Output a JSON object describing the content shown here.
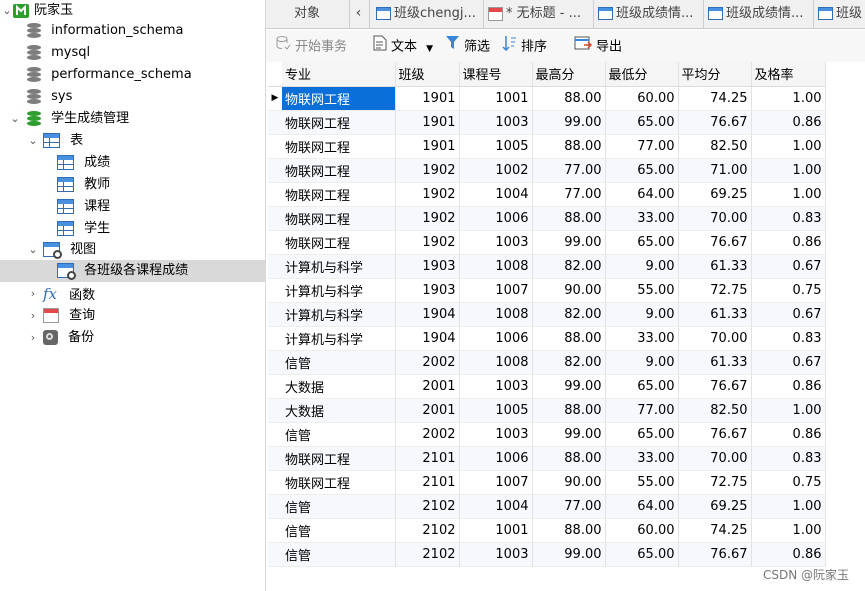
{
  "sidebar": {
    "connection": "阮家玉",
    "databases": [
      "information_schema",
      "mysql",
      "performance_schema",
      "sys"
    ],
    "active_db": "学生成绩管理",
    "tables_label": "表",
    "tables": [
      "成绩",
      "教师",
      "课程",
      "学生"
    ],
    "views_label": "视图",
    "views": [
      "各班级各课程成绩"
    ],
    "functions_label": "函数",
    "queries_label": "查询",
    "backups_label": "备份"
  },
  "tabs": {
    "objects": "对象",
    "items": [
      "班级chengj...",
      "* 无标题 - ...",
      "班级成绩情...",
      "班级成绩情...",
      "班级"
    ]
  },
  "toolbar": {
    "begin_tx": "开始事务",
    "text": "文本",
    "filter": "筛选",
    "sort": "排序",
    "export": "导出"
  },
  "grid": {
    "columns": [
      "专业",
      "班级",
      "课程号",
      "最高分",
      "最低分",
      "平均分",
      "及格率"
    ],
    "rows": [
      [
        "物联网工程",
        "1901",
        "1001",
        "88.00",
        "60.00",
        "74.25",
        "1.00"
      ],
      [
        "物联网工程",
        "1901",
        "1003",
        "99.00",
        "65.00",
        "76.67",
        "0.86"
      ],
      [
        "物联网工程",
        "1901",
        "1005",
        "88.00",
        "77.00",
        "82.50",
        "1.00"
      ],
      [
        "物联网工程",
        "1902",
        "1002",
        "77.00",
        "65.00",
        "71.00",
        "1.00"
      ],
      [
        "物联网工程",
        "1902",
        "1004",
        "77.00",
        "64.00",
        "69.25",
        "1.00"
      ],
      [
        "物联网工程",
        "1902",
        "1006",
        "88.00",
        "33.00",
        "70.00",
        "0.83"
      ],
      [
        "物联网工程",
        "1902",
        "1003",
        "99.00",
        "65.00",
        "76.67",
        "0.86"
      ],
      [
        "计算机与科学",
        "1903",
        "1008",
        "82.00",
        "9.00",
        "61.33",
        "0.67"
      ],
      [
        "计算机与科学",
        "1903",
        "1007",
        "90.00",
        "55.00",
        "72.75",
        "0.75"
      ],
      [
        "计算机与科学",
        "1904",
        "1008",
        "82.00",
        "9.00",
        "61.33",
        "0.67"
      ],
      [
        "计算机与科学",
        "1904",
        "1006",
        "88.00",
        "33.00",
        "70.00",
        "0.83"
      ],
      [
        "信管",
        "2002",
        "1008",
        "82.00",
        "9.00",
        "61.33",
        "0.67"
      ],
      [
        "大数据",
        "2001",
        "1003",
        "99.00",
        "65.00",
        "76.67",
        "0.86"
      ],
      [
        "大数据",
        "2001",
        "1005",
        "88.00",
        "77.00",
        "82.50",
        "1.00"
      ],
      [
        "信管",
        "2002",
        "1003",
        "99.00",
        "65.00",
        "76.67",
        "0.86"
      ],
      [
        "物联网工程",
        "2101",
        "1006",
        "88.00",
        "33.00",
        "70.00",
        "0.83"
      ],
      [
        "物联网工程",
        "2101",
        "1007",
        "90.00",
        "55.00",
        "72.75",
        "0.75"
      ],
      [
        "信管",
        "2102",
        "1004",
        "77.00",
        "64.00",
        "69.25",
        "1.00"
      ],
      [
        "信管",
        "2102",
        "1001",
        "88.00",
        "60.00",
        "74.25",
        "1.00"
      ],
      [
        "信管",
        "2102",
        "1003",
        "99.00",
        "65.00",
        "76.67",
        "0.86"
      ]
    ]
  },
  "watermark": "CSDN @阮家玉",
  "colors": {
    "selection": "#0a6fd8",
    "db_active": "#2e9e2e"
  }
}
